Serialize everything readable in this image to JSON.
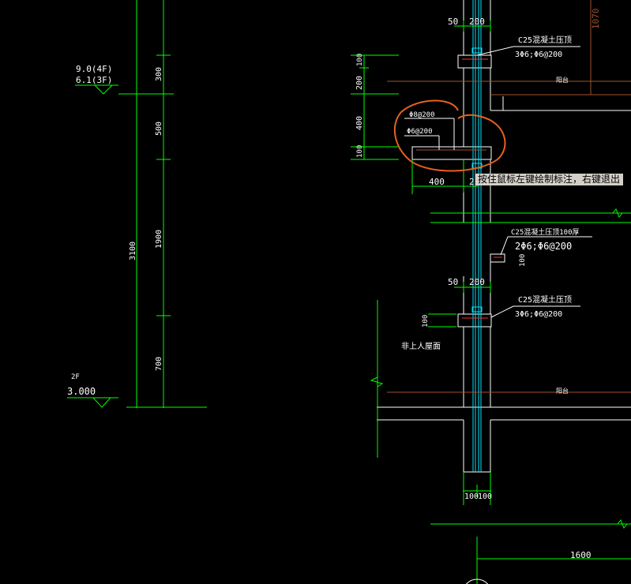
{
  "levels": {
    "top_line1": "9.0(4F)",
    "top_line2": "6.1(3F)",
    "floor_tag": "2F",
    "bottom": "3.000"
  },
  "dimensions": {
    "d300": "300",
    "d500": "500",
    "d1900": "1900",
    "d700": "700",
    "d3100": "3100",
    "left_100a": "100",
    "left_200": "200",
    "left_400": "400",
    "left_100b": "100",
    "top_50": "50",
    "top_200": "200",
    "ledge_400": "400",
    "ledge_2": "2",
    "mid_50": "50",
    "mid_200": "200",
    "mid_100": "100",
    "right_100": "100",
    "bottom_100a": "100",
    "bottom_100b": "100",
    "bottom_1600": "1600",
    "v_1070": "1070"
  },
  "annotations": {
    "beam_top_title": "C25混凝土压顶",
    "beam_top_rebar": "3Φ6;Φ6@200",
    "rebar_8": "Φ8@200",
    "rebar_6": "Φ6@200",
    "upper_balcony": "阳台",
    "parapet_title": "C25混凝土压顶100厚",
    "parapet_rebar": "2Φ6;Φ6@200",
    "beam_mid_title": "C25混凝土压顶",
    "beam_mid_rebar": "3Φ6;Φ6@200",
    "roof_label": "非上人屋面",
    "lower_balcony": "阳台"
  },
  "status": {
    "tooltip": "按住鼠标左键绘制标注，右键退出"
  },
  "colors": {
    "green": "#00ff00",
    "white": "#ffffff",
    "orange": "#e8621f",
    "brown": "#a0522d",
    "red": "#ff3030",
    "cyan": "#00e5ff",
    "tooltip_bg": "#d4d0c8"
  }
}
